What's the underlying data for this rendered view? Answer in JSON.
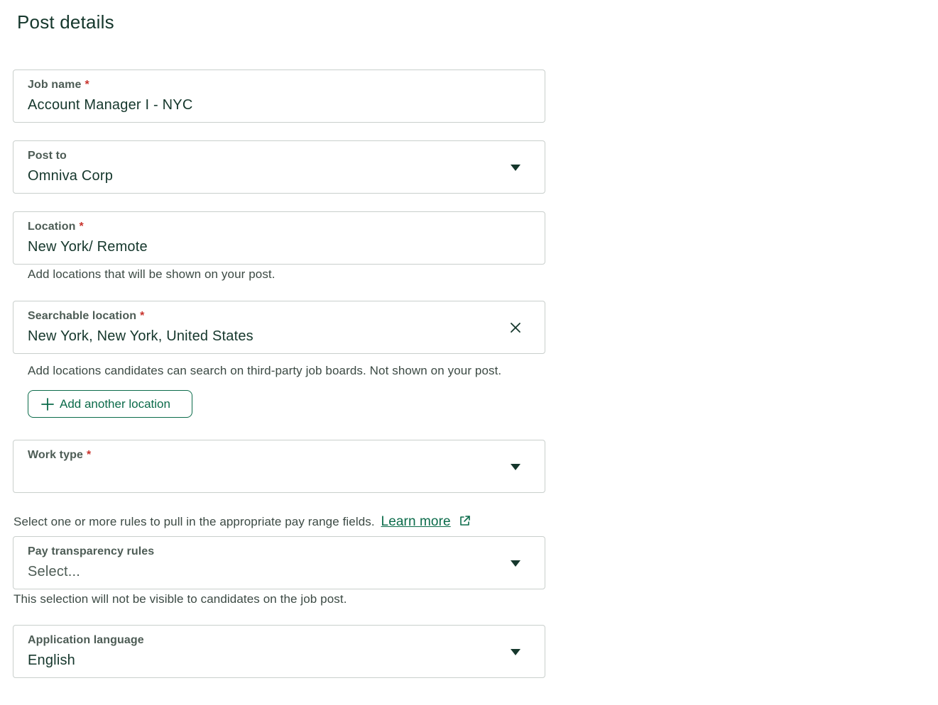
{
  "page": {
    "title": "Post details"
  },
  "fields": {
    "job_name": {
      "label": "Job name",
      "required_mark": "*",
      "value": "Account Manager I - NYC"
    },
    "post_to": {
      "label": "Post to",
      "value": "Omniva Corp"
    },
    "location": {
      "label": "Location",
      "required_mark": "*",
      "value": "New York/ Remote",
      "help": "Add locations that will be shown on your post."
    },
    "searchable_location": {
      "label": "Searchable location",
      "required_mark": "*",
      "value": "New York, New York, United States",
      "help": "Add locations candidates can search on third-party job boards. Not shown on your post."
    },
    "add_location_button": {
      "label": "Add another location"
    },
    "work_type": {
      "label": "Work type",
      "required_mark": "*",
      "value": ""
    },
    "pay_rules_intro": {
      "text": "Select one or more rules to pull in the appropriate pay range fields.",
      "link_label": "Learn more"
    },
    "pay_transparency": {
      "label": "Pay transparency rules",
      "placeholder": "Select...",
      "help": "This selection will not be visible to candidates on the job post."
    },
    "application_language": {
      "label": "Application language",
      "value": "English"
    }
  },
  "icons": {
    "dropdown": "caret-down-icon",
    "clear": "close-icon",
    "add": "plus-icon",
    "external": "external-link-icon"
  },
  "colors": {
    "accent": "#0b6b4a",
    "required": "#c8322c",
    "text": "#15372c",
    "border": "#c9cfcc"
  }
}
